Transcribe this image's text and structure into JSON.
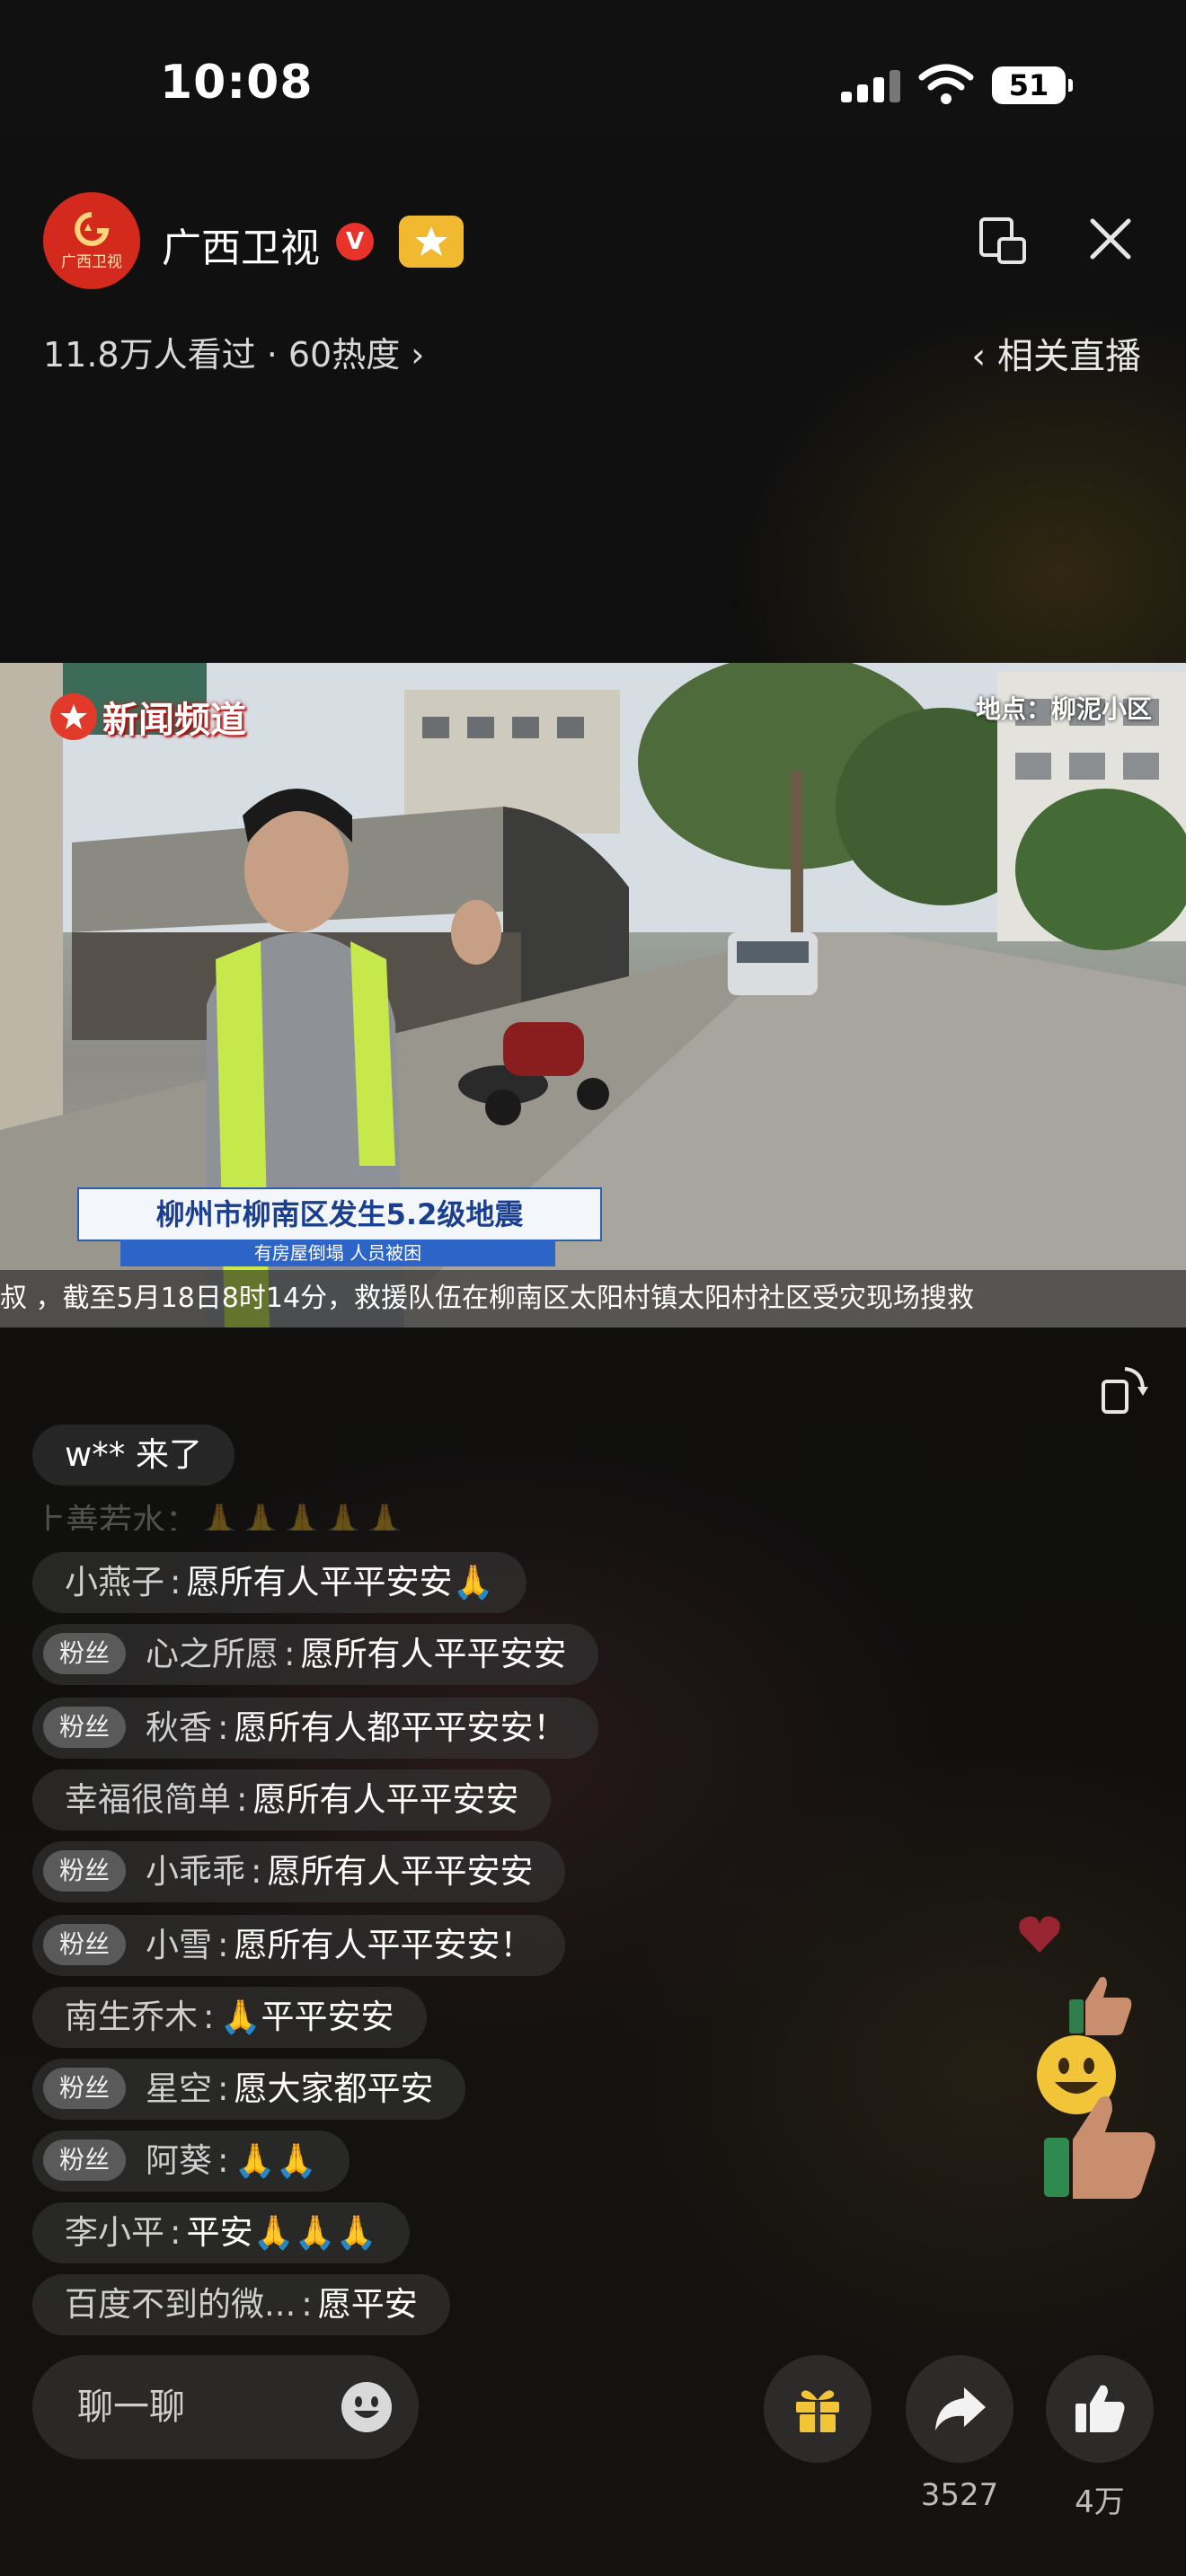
{
  "status_bar": {
    "time": "10:08",
    "battery": "51"
  },
  "header": {
    "channel_name": "广西卫视",
    "avatar_text": "广西卫视",
    "verified_mark": "V",
    "views_text": "11.8万人看过 · 60热度 ›",
    "related_live": "‹ 相关直播"
  },
  "video": {
    "logo_text": "新闻频道",
    "location": "地点：柳泥小区",
    "headline": "柳州市柳南区发生5.2级地震",
    "subline": "有房屋倒塌  人员被困",
    "ticker": "叔        ，截至5月18日8时14分，救援队伍在柳南区太阳村镇太阳村社区受灾现场搜救"
  },
  "comments": {
    "faded_line": "上善若水：🙏🙏🙏🙏🙏",
    "fan_badge": "粉丝",
    "items": [
      {
        "text": "w** 来了"
      },
      {
        "fan": false,
        "user": "小燕子",
        "msg": "愿所有人平平安安🙏"
      },
      {
        "fan": true,
        "user": "心之所愿",
        "msg": "愿所有人平平安安"
      },
      {
        "fan": true,
        "user": "秋香",
        "msg": "愿所有人都平平安安！"
      },
      {
        "fan": false,
        "user": "幸福很简单",
        "msg": "愿所有人平平安安"
      },
      {
        "fan": true,
        "user": "小乖乖",
        "msg": "愿所有人平平安安"
      },
      {
        "fan": true,
        "user": "小雪",
        "msg": "愿所有人平平安安！"
      },
      {
        "fan": false,
        "user": "南生乔木",
        "msg": "🙏平平安安"
      },
      {
        "fan": true,
        "user": "星空",
        "msg": "愿大家都平安"
      },
      {
        "fan": true,
        "user": "阿葵",
        "msg": "🙏🙏"
      },
      {
        "fan": false,
        "user": "李小平",
        "msg": "平安🙏🙏🙏"
      },
      {
        "fan": false,
        "user": "百度不到的微...",
        "msg": "愿平安"
      }
    ]
  },
  "bottom_bar": {
    "chat_placeholder": "聊一聊",
    "share_count": "3527",
    "like_count": "4万"
  },
  "icons": [
    "signal-icon",
    "wifi-icon",
    "pip-icon",
    "close-icon",
    "rotate-icon",
    "emoji-icon",
    "gift-icon",
    "share-icon",
    "like-icon"
  ],
  "colors": {
    "verified": "#e8322a",
    "star_badge": "#f1b92f",
    "avatar": "#d42a1e",
    "headline_text": "#1a3f8f",
    "subline_bg": "#2c64c8"
  }
}
